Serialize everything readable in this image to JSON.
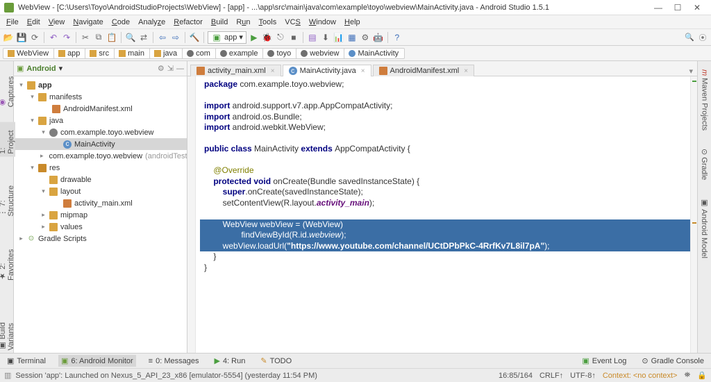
{
  "titlebar": {
    "text": "WebView - [C:\\Users\\Toyo\\AndroidStudioProjects\\WebView] - [app] - ...\\app\\src\\main\\java\\com\\example\\toyo\\webview\\MainActivity.java - Android Studio 1.5.1"
  },
  "menubar": [
    "File",
    "Edit",
    "View",
    "Navigate",
    "Code",
    "Analyze",
    "Refactor",
    "Build",
    "Run",
    "Tools",
    "VCS",
    "Window",
    "Help"
  ],
  "toolbar": {
    "app_combo": "app"
  },
  "breadcrumbs": [
    "WebView",
    "app",
    "src",
    "main",
    "java",
    "com",
    "example",
    "toyo",
    "webview",
    "MainActivity"
  ],
  "left_tabs": [
    "Captures",
    "1: Project",
    "7: Structure",
    "2: Favorites",
    "Build Variants"
  ],
  "right_tabs": [
    "Maven Projects",
    "Gradle",
    "Android Model"
  ],
  "project_header": {
    "view": "Android"
  },
  "tree": {
    "app": "app",
    "manifests": "manifests",
    "manifest_file": "AndroidManifest.xml",
    "java": "java",
    "pkg1": "com.example.toyo.webview",
    "main_activity": "MainActivity",
    "pkg2": "com.example.toyo.webview",
    "pkg2_suffix": "(androidTest)",
    "res": "res",
    "drawable": "drawable",
    "layout": "layout",
    "activity_main": "activity_main.xml",
    "mipmap": "mipmap",
    "values": "values",
    "gradle_scripts": "Gradle Scripts"
  },
  "editor_tabs": [
    {
      "label": "activity_main.xml",
      "icon": "xml"
    },
    {
      "label": "MainActivity.java",
      "icon": "class",
      "active": true
    },
    {
      "label": "AndroidManifest.xml",
      "icon": "xml"
    }
  ],
  "code": {
    "l1a": "package",
    "l1b": " com.example.toyo.webview;",
    "l3a": "import",
    "l3b": " android.support.v7.app.AppCompatActivity;",
    "l4a": "import",
    "l4b": " android.os.Bundle;",
    "l5a": "import",
    "l5b": " android.webkit.WebView;",
    "l7a": "public class ",
    "l7b": "MainActivity ",
    "l7c": "extends ",
    "l7d": "AppCompatActivity {",
    "l9": "    @Override",
    "l10a": "    ",
    "l10b": "protected void ",
    "l10c": "onCreate(Bundle savedInstanceState) {",
    "l11a": "        ",
    "l11b": "super",
    "l11c": ".onCreate(savedInstanceState);",
    "l12a": "        setContentView(R.layout.",
    "l12b": "activity_main",
    "l12c": ");",
    "l14a": "        WebView webView = (WebView)",
    "l15a": "                findViewById(R.id.",
    "l15b": "webview",
    "l15c": ");",
    "l16a": "        webView.loadUrl(",
    "l16b": "\"https://www.youtube.com/channel/UCtDPbPkC-4RrfKv7L8il7pA\"",
    "l16c": ");",
    "l17": "    }",
    "l18": "}"
  },
  "bottom_tabs": {
    "terminal": "Terminal",
    "android_monitor": "6: Android Monitor",
    "messages": "0: Messages",
    "run": "4: Run",
    "todo": "TODO",
    "event_log": "Event Log",
    "gradle_console": "Gradle Console"
  },
  "status": {
    "msg": "Session 'app': Launched on Nexus_5_API_23_x86 [emulator-5554] (yesterday 11:54 PM)",
    "pos": "16:85/164",
    "eol": "CRLF↑",
    "enc": "UTF-8↑",
    "ctx": "Context: <no context>"
  }
}
